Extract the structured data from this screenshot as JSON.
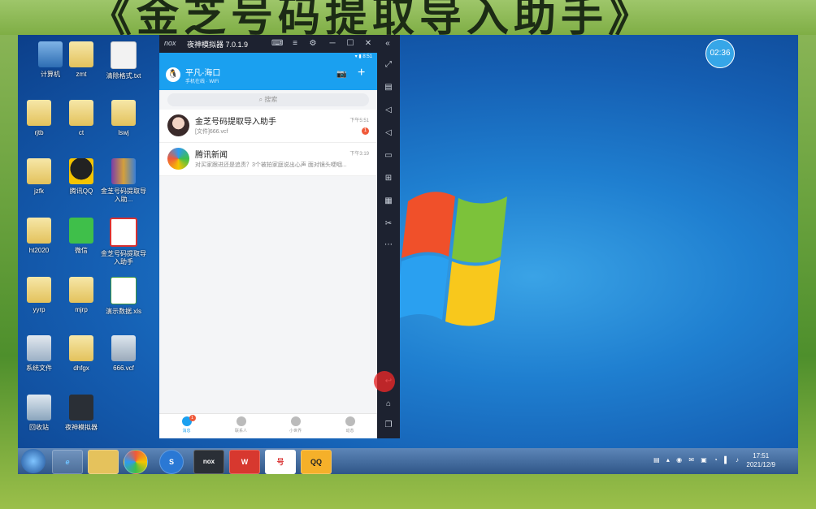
{
  "banner": {
    "text": "《金芝号码提取导入助手》"
  },
  "desktop": {
    "icons": [
      {
        "label": "计算机"
      },
      {
        "label": "zmt"
      },
      {
        "label": "清除格式.txt"
      },
      {
        "label": "rjtb"
      },
      {
        "label": "ct"
      },
      {
        "label": "lswj"
      },
      {
        "label": "jzfk"
      },
      {
        "label": "腾讯QQ"
      },
      {
        "label": "金芝号码提取导入助..."
      },
      {
        "label": "ht2020"
      },
      {
        "label": "微信"
      },
      {
        "label": "金芝号码提取导入助手"
      },
      {
        "label": "yyrp"
      },
      {
        "label": "mjrp"
      },
      {
        "label": "演示数据.xls"
      },
      {
        "label": "系统文件"
      },
      {
        "label": "dhfgx"
      },
      {
        "label": "666.vcf"
      },
      {
        "label": "回收站"
      },
      {
        "label": "夜神模拟器"
      }
    ],
    "clock_badge": "02:36"
  },
  "emulator": {
    "logo": "nox",
    "title": "夜神模拟器 7.0.1.9",
    "status_time": "8:51",
    "qq": {
      "user_name": "平凡-海口",
      "user_status": "手机在线 · WiFi",
      "search_placeholder": "搜索",
      "chats": [
        {
          "title": "金芝号码提取导入助手",
          "message": "[文件]666.vcf",
          "time": "下午5:51",
          "badge": "1"
        },
        {
          "title": "腾讯新闻",
          "message": "对买家跟进还是追责？3个被拍家庭说出心声 面对镜头哽咽...",
          "time": "下午3:19",
          "badge": ""
        }
      ],
      "tabs": [
        {
          "label": "消息",
          "badge": "1"
        },
        {
          "label": "联系人",
          "badge": ""
        },
        {
          "label": "小世界",
          "badge": ""
        },
        {
          "label": "动态",
          "badge": ""
        }
      ]
    }
  },
  "taskbar": {
    "apps": [
      "e",
      "",
      "",
      "S",
      "nox",
      "W",
      "号",
      "QQ"
    ],
    "time": "17:51",
    "date": "2021/12/9"
  }
}
